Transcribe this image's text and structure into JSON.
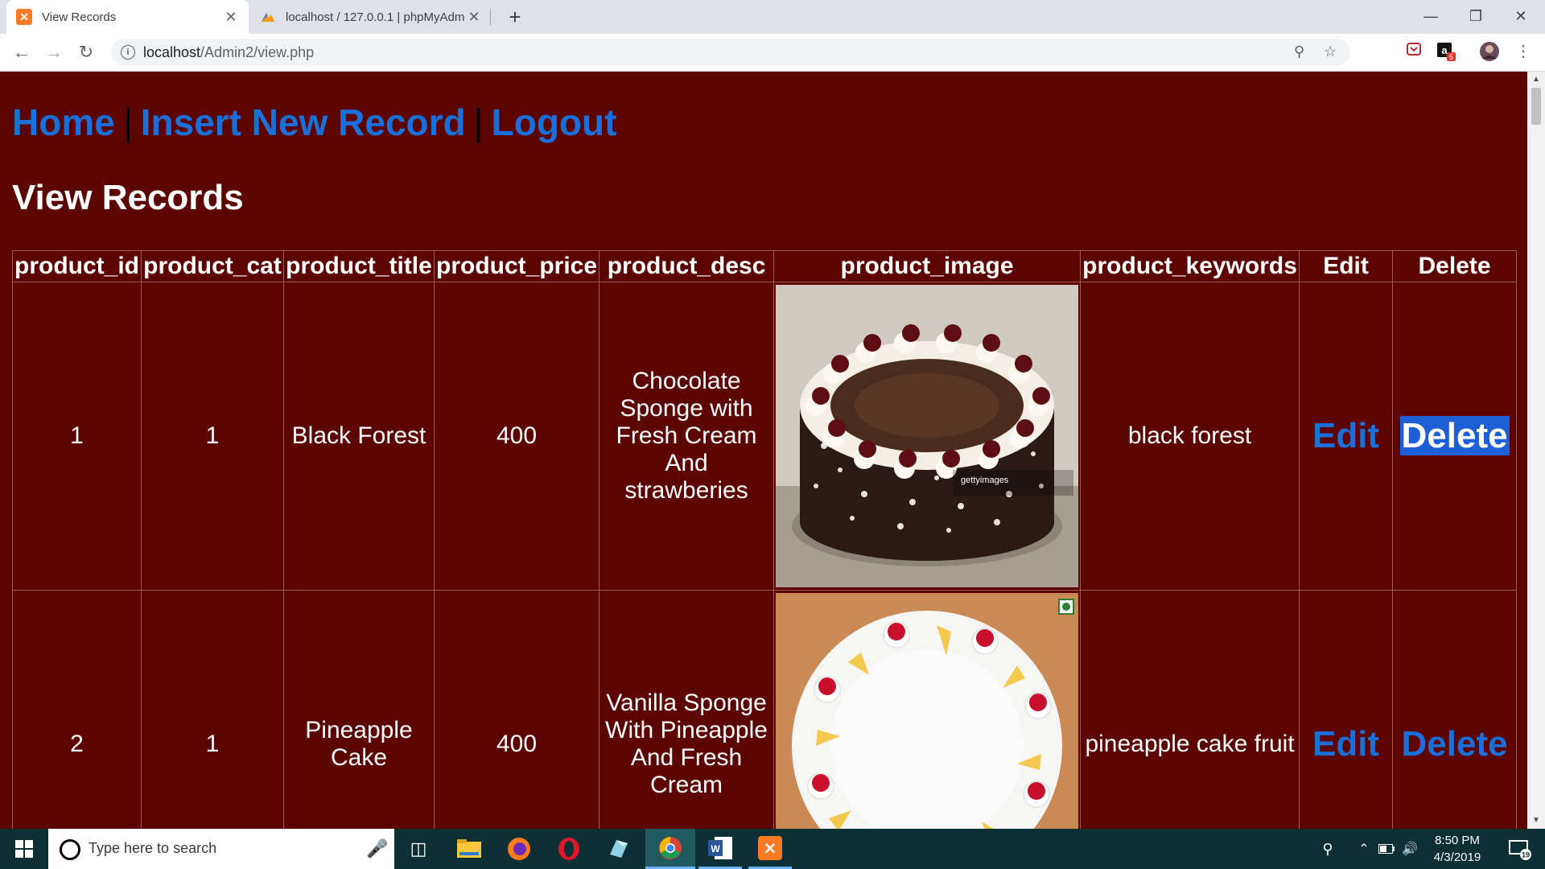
{
  "browser": {
    "tabs": [
      {
        "title": "View Records",
        "active": true
      },
      {
        "title": "localhost / 127.0.0.1 | phpMyAdm",
        "active": false
      }
    ],
    "url_host": "localhost",
    "url_path": "/Admin2/view.php"
  },
  "page": {
    "nav": {
      "home": "Home",
      "insert": "Insert New Record",
      "logout": "Logout",
      "separator": "|"
    },
    "heading": "View Records",
    "columns": [
      "product_id",
      "product_cat",
      "product_title",
      "product_price",
      "product_desc",
      "product_image",
      "product_keywords",
      "Edit",
      "Delete"
    ],
    "rows": [
      {
        "id": "1",
        "cat": "1",
        "title": "Black Forest",
        "price": "400",
        "desc": "Chocolate Sponge with Fresh Cream And strawberies",
        "image": "black-forest-cake",
        "keywords": "black forest",
        "edit": "Edit",
        "delete": "Delete"
      },
      {
        "id": "2",
        "cat": "1",
        "title": "Pineapple Cake",
        "price": "400",
        "desc": "Vanilla Sponge With Pineapple And Fresh Cream",
        "image": "pineapple-cake",
        "keywords": "pineapple cake fruit",
        "edit": "Edit",
        "delete": "Delete"
      }
    ],
    "image_watermark": "gettyimages"
  },
  "taskbar": {
    "search_placeholder": "Type here to search",
    "time": "8:50 PM",
    "date": "4/3/2019",
    "notification_count": "19"
  },
  "extension_badge": "5",
  "colors": {
    "page_bg": "#5c0500",
    "link": "#1a6fd8",
    "taskbar": "#0b2f33"
  }
}
